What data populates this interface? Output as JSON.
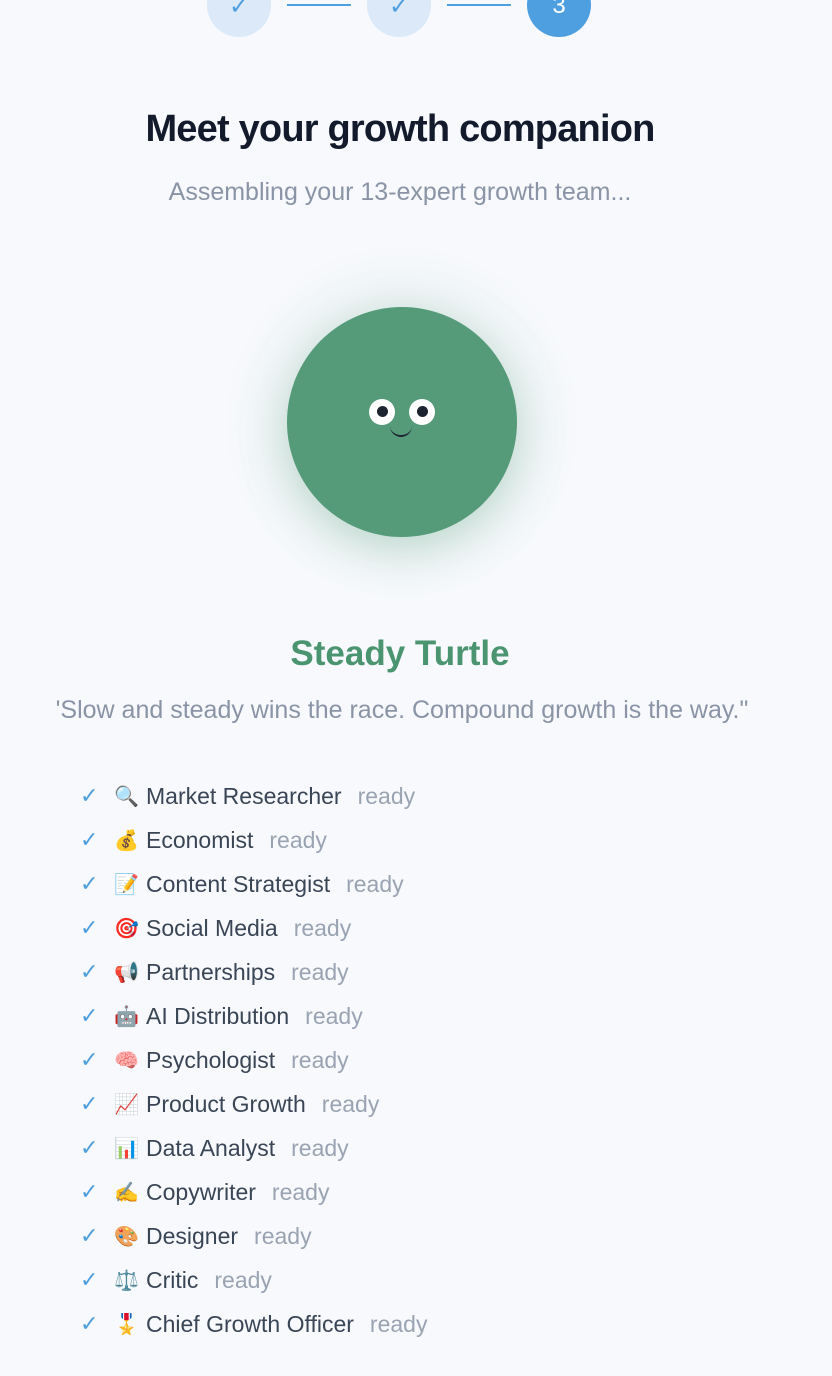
{
  "stepper": {
    "steps": [
      {
        "label": "✓",
        "state": "done"
      },
      {
        "label": "✓",
        "state": "done"
      },
      {
        "label": "3",
        "state": "current"
      }
    ]
  },
  "header": {
    "title": "Meet your growth companion",
    "subtitle": "Assembling your 13-expert growth team..."
  },
  "companion": {
    "avatar_color": "#559b7a",
    "name": "Steady Turtle",
    "name_color": "#4a9470",
    "quote": "'Slow and steady wins the race. Compound growth is the way.\""
  },
  "experts": [
    {
      "icon": "🔍",
      "name": "Market Researcher",
      "status": "ready"
    },
    {
      "icon": "💰",
      "name": "Economist",
      "status": "ready"
    },
    {
      "icon": "📝",
      "name": "Content Strategist",
      "status": "ready"
    },
    {
      "icon": "🎯",
      "name": "Social Media",
      "status": "ready"
    },
    {
      "icon": "📢",
      "name": "Partnerships",
      "status": "ready"
    },
    {
      "icon": "🤖",
      "name": "AI Distribution",
      "status": "ready"
    },
    {
      "icon": "🧠",
      "name": "Psychologist",
      "status": "ready"
    },
    {
      "icon": "📈",
      "name": "Product Growth",
      "status": "ready"
    },
    {
      "icon": "📊",
      "name": "Data Analyst",
      "status": "ready"
    },
    {
      "icon": "✍️",
      "name": "Copywriter",
      "status": "ready"
    },
    {
      "icon": "🎨",
      "name": "Designer",
      "status": "ready"
    },
    {
      "icon": "⚖️",
      "name": "Critic",
      "status": "ready"
    },
    {
      "icon": "🎖️",
      "name": "Chief Growth Officer",
      "status": "ready"
    }
  ],
  "colors": {
    "accent": "#4d9fe0",
    "background": "#f7f9fc"
  }
}
